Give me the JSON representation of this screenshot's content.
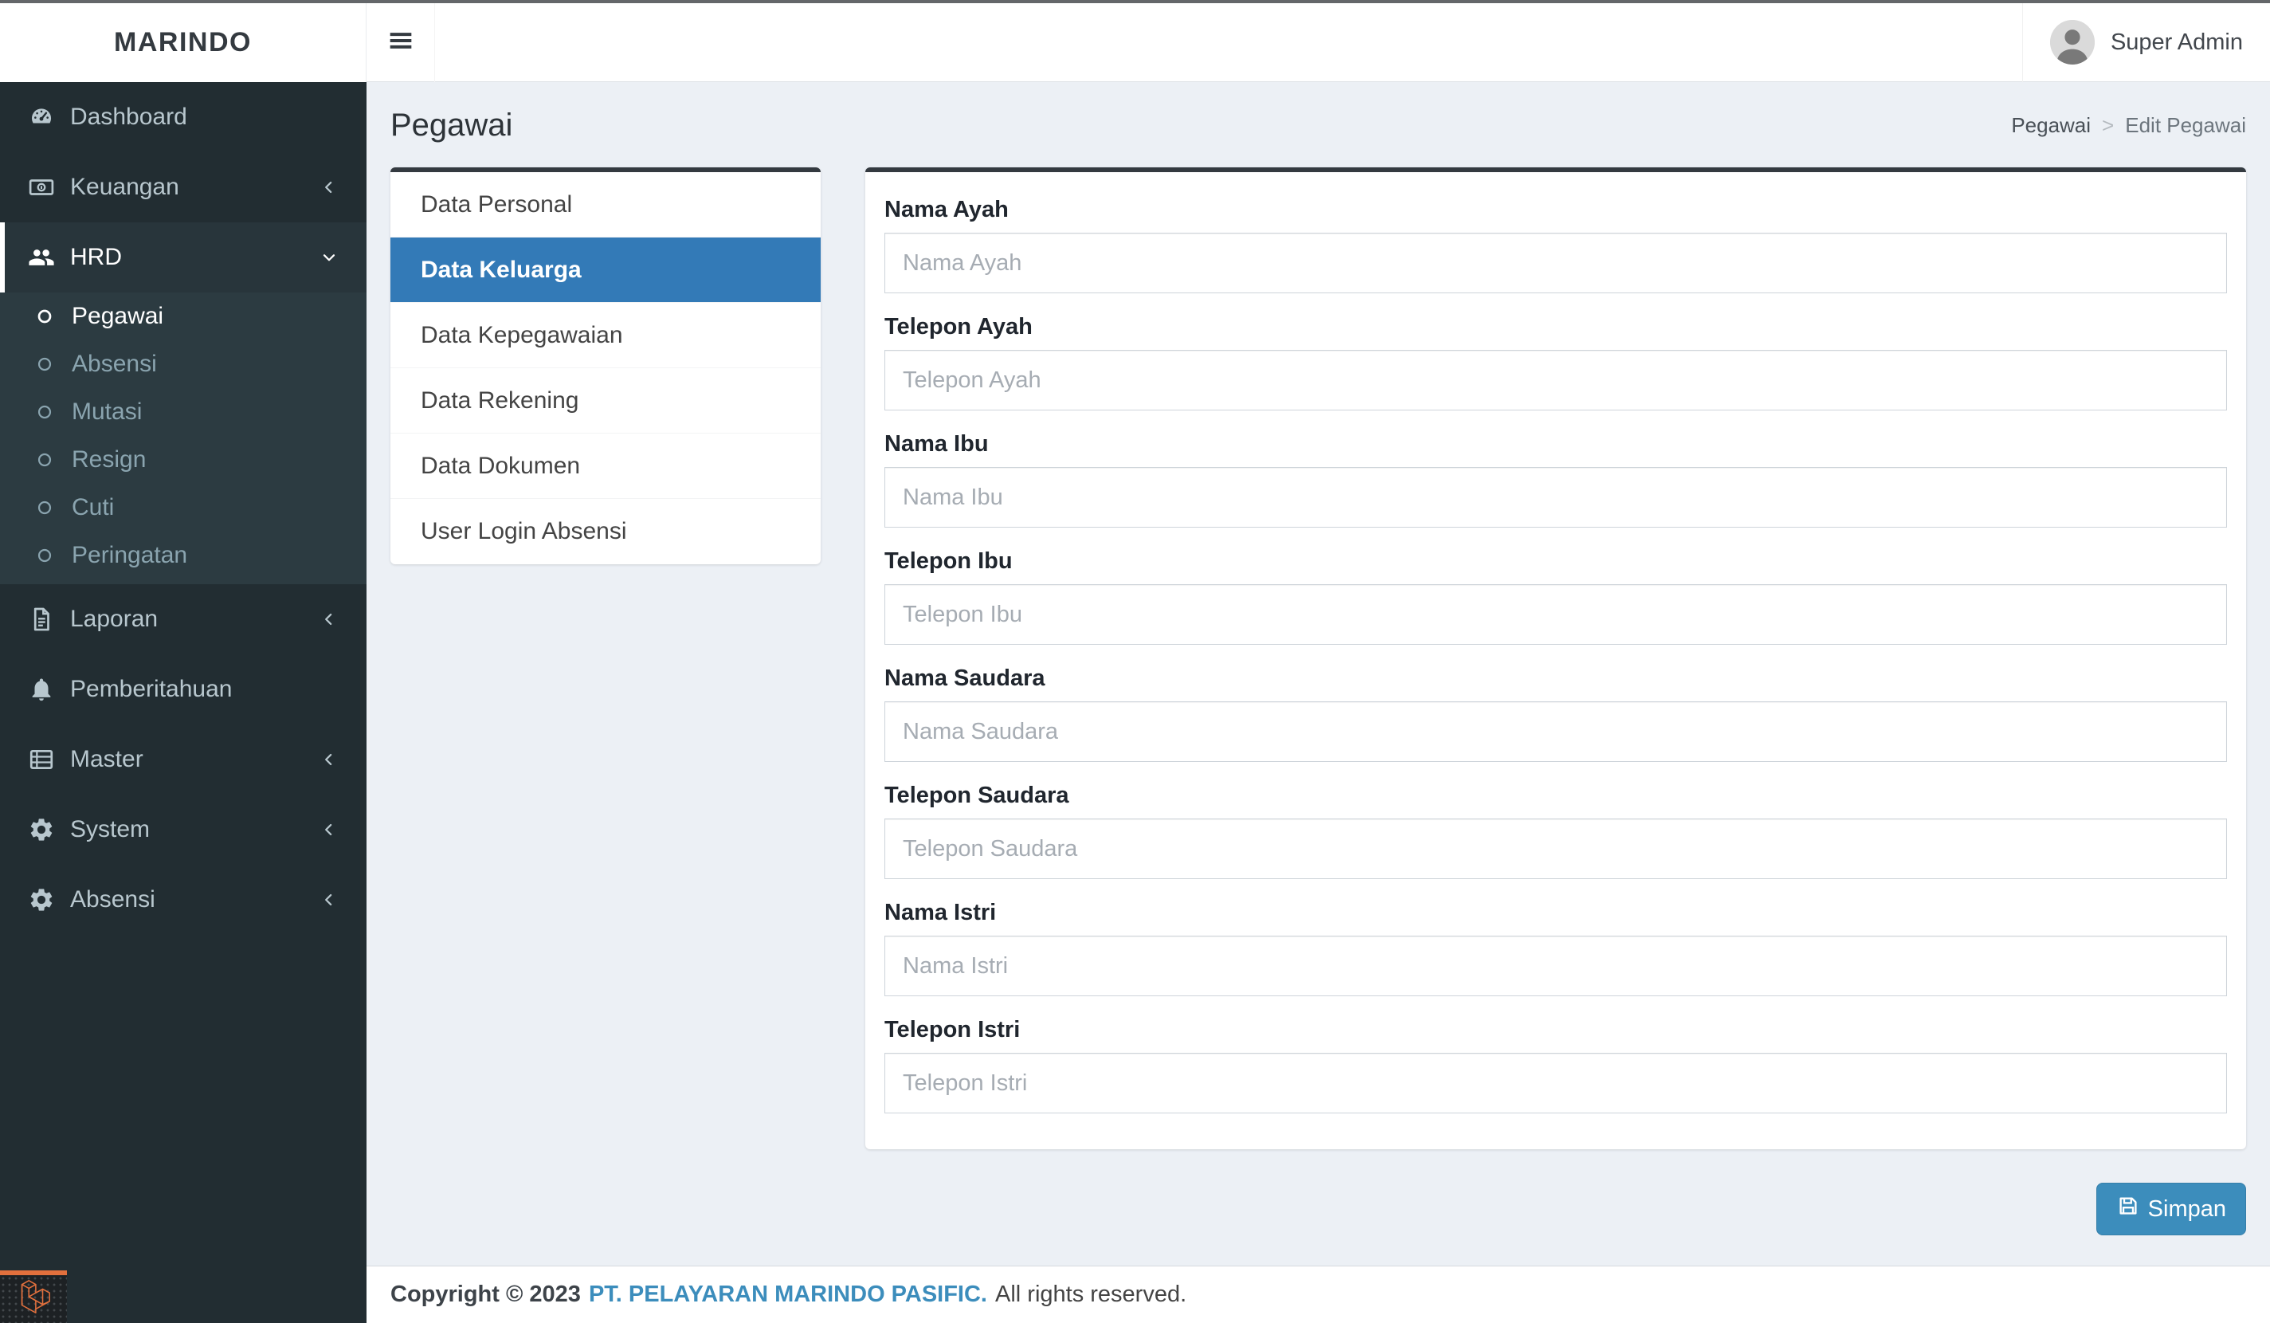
{
  "colors": {
    "sidebar_bg": "#222d32",
    "sidebar_text": "#b8c7ce",
    "active_tab_blue": "#337ab7",
    "primary_button_blue": "#3c8dbc",
    "card_top_border": "#343a40",
    "content_bg": "#ecf0f5",
    "laravel_orange": "#e2703d"
  },
  "sidebar": {
    "logo": "MARINDO",
    "items": [
      {
        "label": "Dashboard",
        "icon": "tachometer-icon",
        "chevron": "none"
      },
      {
        "label": "Keuangan",
        "icon": "money-bill-icon",
        "chevron": "left"
      },
      {
        "label": "HRD",
        "icon": "users-icon",
        "chevron": "down",
        "active": true
      },
      {
        "label": "Laporan",
        "icon": "file-text-icon",
        "chevron": "left"
      },
      {
        "label": "Pemberitahuan",
        "icon": "bell-icon",
        "chevron": "none"
      },
      {
        "label": "Master",
        "icon": "list-icon",
        "chevron": "left"
      },
      {
        "label": "System",
        "icon": "gear-icon",
        "chevron": "left"
      },
      {
        "label": "Absensi",
        "icon": "gear-icon",
        "chevron": "left"
      }
    ],
    "hrd_submenu": [
      {
        "label": "Pegawai",
        "active": true
      },
      {
        "label": "Absensi",
        "active": false
      },
      {
        "label": "Mutasi",
        "active": false
      },
      {
        "label": "Resign",
        "active": false
      },
      {
        "label": "Cuti",
        "active": false
      },
      {
        "label": "Peringatan",
        "active": false
      }
    ]
  },
  "navbar": {
    "user_name": "Super Admin"
  },
  "header": {
    "title": "Pegawai",
    "breadcrumb": {
      "parent": "Pegawai",
      "separator": ">",
      "current": "Edit Pegawai"
    }
  },
  "tabs": {
    "items": [
      {
        "label": "Data Personal",
        "active": false
      },
      {
        "label": "Data Keluarga",
        "active": true
      },
      {
        "label": "Data Kepegawaian",
        "active": false
      },
      {
        "label": "Data Rekening",
        "active": false
      },
      {
        "label": "Data Dokumen",
        "active": false
      },
      {
        "label": "User Login Absensi",
        "active": false
      }
    ]
  },
  "form": {
    "fields": [
      {
        "label": "Nama Ayah",
        "placeholder": "Nama Ayah",
        "value": ""
      },
      {
        "label": "Telepon Ayah",
        "placeholder": "Telepon Ayah",
        "value": ""
      },
      {
        "label": "Nama Ibu",
        "placeholder": "Nama Ibu",
        "value": ""
      },
      {
        "label": "Telepon Ibu",
        "placeholder": "Telepon Ibu",
        "value": ""
      },
      {
        "label": "Nama Saudara",
        "placeholder": "Nama Saudara",
        "value": ""
      },
      {
        "label": "Telepon Saudara",
        "placeholder": "Telepon Saudara",
        "value": ""
      },
      {
        "label": "Nama Istri",
        "placeholder": "Nama Istri",
        "value": ""
      },
      {
        "label": "Telepon Istri",
        "placeholder": "Telepon Istri",
        "value": ""
      }
    ],
    "save_label": "Simpan"
  },
  "footer": {
    "copyright": "Copyright © 2023",
    "company": "PT. PELAYARAN MARINDO PASIFIC.",
    "rights": "All rights reserved."
  }
}
